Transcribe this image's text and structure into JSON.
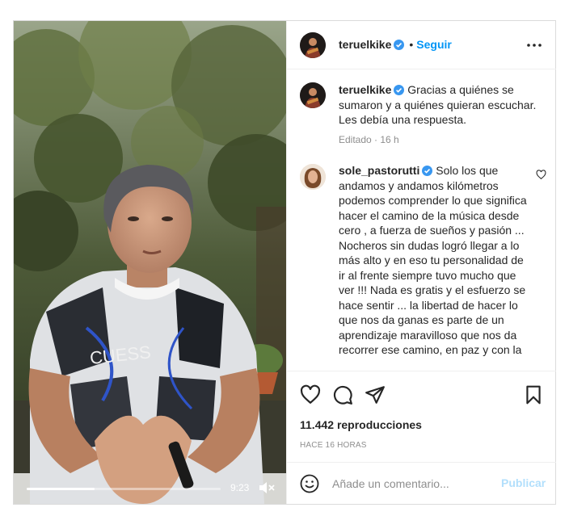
{
  "video": {
    "progress": 0.35,
    "time": "9:23",
    "mute_icon": "speaker-muted-icon",
    "shirt_text": "CUESS"
  },
  "header": {
    "username": "teruelkike",
    "dot": "•",
    "follow_label": "Seguir",
    "more_icon": "more-options-icon"
  },
  "caption": {
    "username": "teruelkike",
    "text": "Gracias a quiénes se sumaron y a quiénes quieran escuchar. Les debía una respuesta.",
    "edited": "Editado",
    "sep": " · ",
    "time": "16 h"
  },
  "comments": [
    {
      "username": "sole_pastorutti",
      "text": "Solo los que andamos y andamos kilómetros podemos comprender lo que significa hacer el camino de la música desde cero , a fuerza de sueños y pasión ... Nocheros sin dudas logró llegar a lo más alto y en eso tu personalidad de ir al frente siempre tuvo mucho que ver !!! Nada es gratis y el esfuerzo se hace sentir ... la libertad de hacer lo que nos da ganas es parte de un aprendizaje maravilloso que nos da recorrer ese camino, en paz y con la"
    }
  ],
  "actions": {
    "like_icon": "heart-icon",
    "comment_icon": "comment-icon",
    "share_icon": "share-icon",
    "save_icon": "bookmark-icon",
    "views": "11.442 reproducciones",
    "posted": "HACE 16 HORAS"
  },
  "add_comment": {
    "placeholder": "Añade un comentario...",
    "publish_label": "Publicar",
    "emoji_icon": "emoji-icon"
  },
  "colors": {
    "accent": "#0095f6",
    "publish_disabled": "#b2dffc",
    "verified": "#3897f0",
    "muted_text": "#8e8e8e"
  }
}
